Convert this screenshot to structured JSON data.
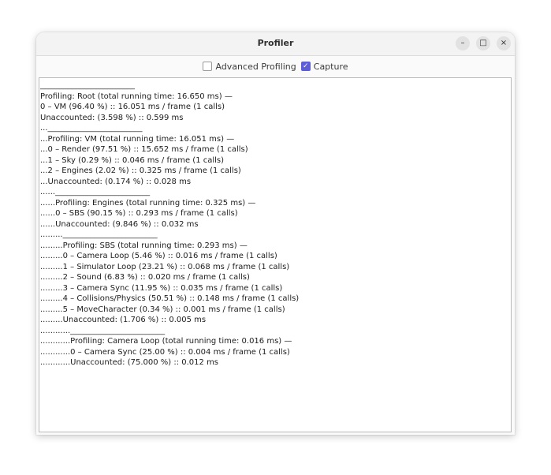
{
  "window": {
    "title": "Profiler",
    "controls": {
      "minimize": "–",
      "maximize": "□",
      "close": "×"
    }
  },
  "toolbar": {
    "advanced_profiling_label": "Advanced Profiling",
    "advanced_profiling_checked": false,
    "capture_label": "Capture",
    "capture_checked": true
  },
  "accent_color": "#5e5ed6",
  "output_lines": [
    "________________________",
    "Profiling: Root (total running time: 16.650 ms) —",
    "0 – VM (96.40 %) :: 16.051 ms / frame (1 calls)",
    "Unaccounted: (3.598 %) :: 0.599 ms",
    "...________________________",
    "...Profiling: VM (total running time: 16.051 ms) —",
    "...0 – Render (97.51 %) :: 15.652 ms / frame (1 calls)",
    "...1 – Sky (0.29 %) :: 0.046 ms / frame (1 calls)",
    "...2 – Engines (2.02 %) :: 0.325 ms / frame (1 calls)",
    "...Unaccounted: (0.174 %) :: 0.028 ms",
    "......________________________",
    "......Profiling: Engines (total running time: 0.325 ms) —",
    "......0 – SBS (90.15 %) :: 0.293 ms / frame (1 calls)",
    "......Unaccounted: (9.846 %) :: 0.032 ms",
    ".........________________________",
    ".........Profiling: SBS (total running time: 0.293 ms) —",
    ".........0 – Camera Loop (5.46 %) :: 0.016 ms / frame (1 calls)",
    ".........1 – Simulator Loop (23.21 %) :: 0.068 ms / frame (1 calls)",
    ".........2 – Sound (6.83 %) :: 0.020 ms / frame (1 calls)",
    ".........3 – Camera Sync (11.95 %) :: 0.035 ms / frame (1 calls)",
    ".........4 – Collisions/Physics (50.51 %) :: 0.148 ms / frame (1 calls)",
    ".........5 – MoveCharacter (0.34 %) :: 0.001 ms / frame (1 calls)",
    ".........Unaccounted: (1.706 %) :: 0.005 ms",
    "............________________________",
    "............Profiling: Camera Loop (total running time: 0.016 ms) —",
    "............0 – Camera Sync (25.00 %) :: 0.004 ms / frame (1 calls)",
    "............Unaccounted: (75.000 %) :: 0.012 ms"
  ]
}
